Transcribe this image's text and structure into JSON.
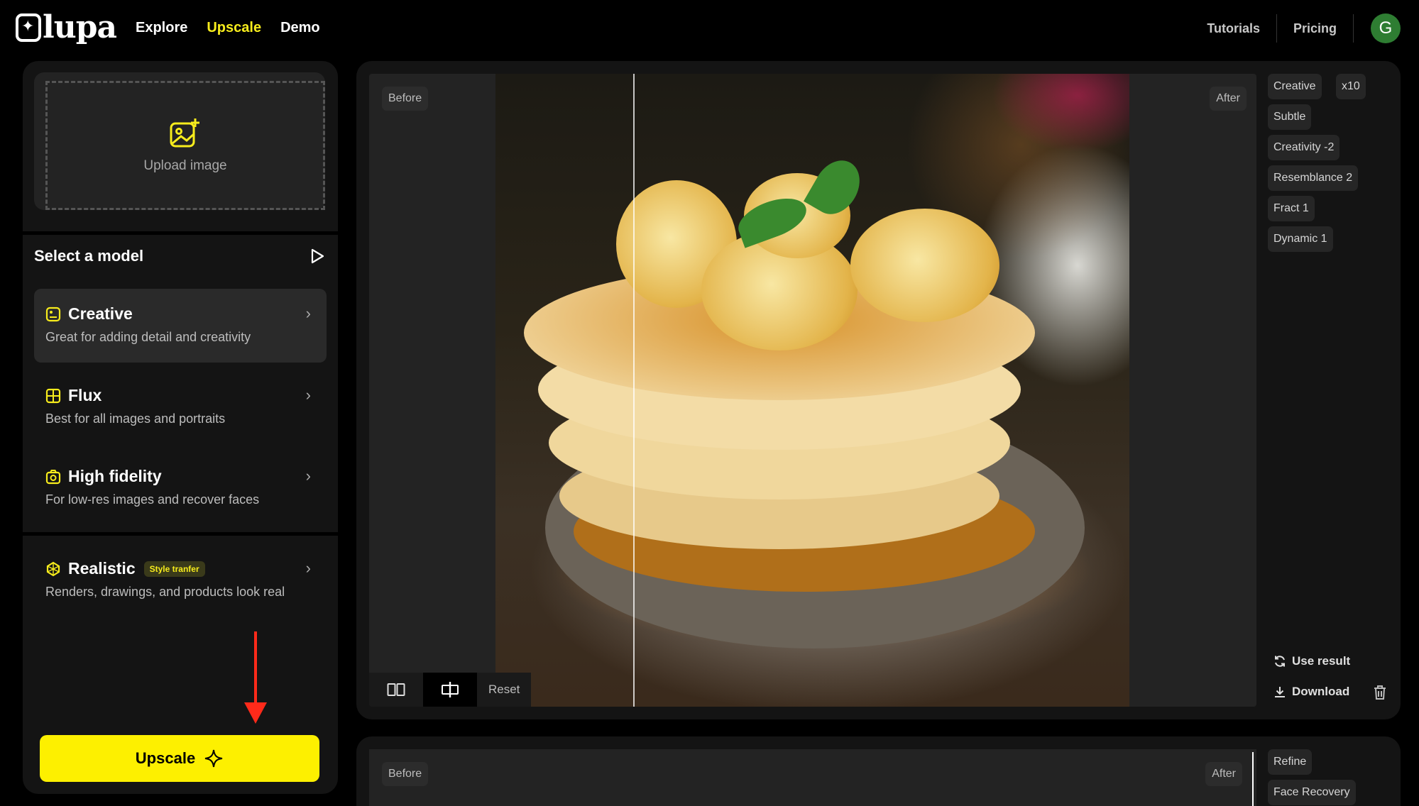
{
  "header": {
    "logo_text": "lupa",
    "nav": [
      "Explore",
      "Upscale",
      "Demo"
    ],
    "active_nav": "Upscale",
    "links": [
      "Tutorials",
      "Pricing"
    ],
    "avatar_initial": "G"
  },
  "left": {
    "upload_label": "Upload image",
    "select_title": "Select a model",
    "models": [
      {
        "name": "Creative",
        "desc": "Great for adding detail and creativity",
        "icon": "creative-icon"
      },
      {
        "name": "Flux",
        "desc": "Best for all images and portraits",
        "icon": "flux-grid-icon"
      },
      {
        "name": "High fidelity",
        "desc": "For low-res images and recover faces",
        "icon": "camera-icon"
      },
      {
        "name": "Realistic",
        "desc": "Renders, drawings, and products look real",
        "icon": "realistic-icon",
        "badge": "Style tranfer"
      }
    ],
    "upscale_button": "Upscale"
  },
  "viewer": {
    "before_label": "Before",
    "after_label": "After",
    "reset_label": "Reset",
    "split_position": 0.217
  },
  "tags": {
    "items": [
      "Creative",
      "x10",
      "Subtle",
      "Creativity -2",
      "Resemblance 2",
      "Fract 1",
      "Dynamic 1"
    ]
  },
  "actions": {
    "use_result": "Use result",
    "download": "Download"
  },
  "second": {
    "before_label": "Before",
    "after_label": "After",
    "tags": [
      "Refine",
      "Face Recovery"
    ]
  },
  "colors": {
    "accent_yellow": "#fdf000",
    "nav_active": "#f7ec1c",
    "avatar": "#2e7d32",
    "arrow": "#ff2a1a"
  }
}
